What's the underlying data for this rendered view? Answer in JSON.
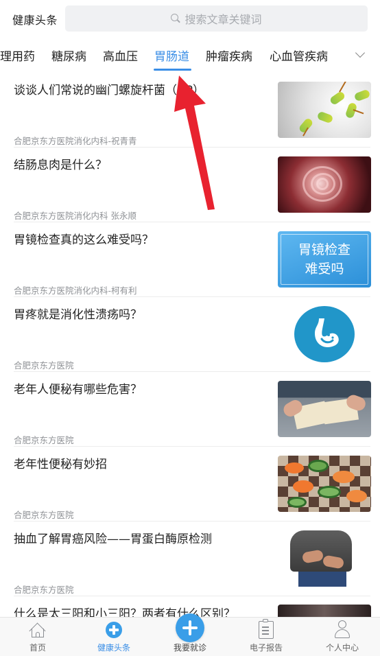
{
  "header": {
    "app_title": "健康头条",
    "search_placeholder": "搜索文章关键词"
  },
  "tabs": [
    {
      "label": "理用药",
      "active": false
    },
    {
      "label": "糖尿病",
      "active": false
    },
    {
      "label": "高血压",
      "active": false
    },
    {
      "label": "胃肠道",
      "active": true
    },
    {
      "label": "肿瘤疾病",
      "active": false
    },
    {
      "label": "心血管疾病",
      "active": false
    }
  ],
  "articles": [
    {
      "title": "谈谈人们常说的幽门螺旋杆菌（HP）",
      "source": "合肥京东方医院消化内科-祝青青",
      "thumb": "bacteria"
    },
    {
      "title": "结肠息肉是什么？",
      "source": "合肥京东方医院消化内科 张永顺",
      "thumb": "colon"
    },
    {
      "title": "胃镜检查真的这么难受吗？",
      "source": "合肥京东方医院消化内科-柯有利",
      "thumb": "text",
      "thumb_text_line1": "胃镜检查",
      "thumb_text_line2": "难受吗"
    },
    {
      "title": "胃疼就是消化性溃疡吗？",
      "source": "合肥京东方医院",
      "thumb": "stomach"
    },
    {
      "title": "老年人便秘有哪些危害？",
      "source": "合肥京东方医院",
      "thumb": "book"
    },
    {
      "title": "老年性便秘有妙招",
      "source": "合肥京东方医院",
      "thumb": "cucumber"
    },
    {
      "title": "抽血了解胃癌风险——胃蛋白酶原检测",
      "source": "合肥京东方医院",
      "thumb": "belly"
    },
    {
      "title": "什么是太三阳和小三阳？两者有什么区别？",
      "source": "",
      "thumb": "dark"
    }
  ],
  "bottom_nav": [
    {
      "label": "首页",
      "icon": "home-icon",
      "active": false
    },
    {
      "label": "健康头条",
      "icon": "health-plus-icon",
      "active": true
    },
    {
      "label": "我要就诊",
      "icon": "add-visit-icon",
      "active": false
    },
    {
      "label": "电子报告",
      "icon": "clipboard-icon",
      "active": false
    },
    {
      "label": "个人中心",
      "icon": "user-icon",
      "active": false
    }
  ],
  "colors": {
    "accent": "#3a8ee6",
    "annotation_arrow": "#e8222f"
  }
}
